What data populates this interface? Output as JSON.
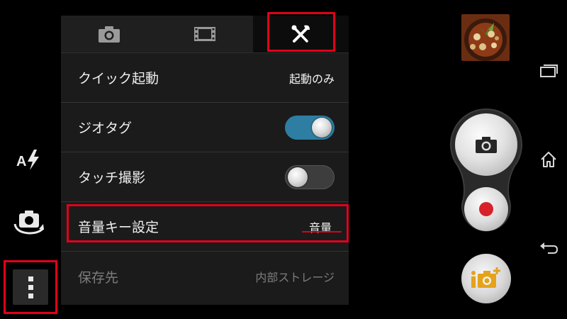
{
  "left_rail": {
    "flash_icon": "auto-flash-icon",
    "switch_camera_icon": "switch-camera-icon",
    "more_icon": "more-vertical-icon"
  },
  "tabs": [
    {
      "icon": "camera-icon",
      "selected": false
    },
    {
      "icon": "film-icon",
      "selected": false
    },
    {
      "icon": "tools-icon",
      "selected": true
    }
  ],
  "settings": {
    "quick_launch": {
      "label": "クイック起動",
      "value": "起動のみ"
    },
    "geotag": {
      "label": "ジオタグ",
      "state": "on"
    },
    "touch_capture": {
      "label": "タッチ撮影",
      "state": "off"
    },
    "volume_key": {
      "label": "音量キー設定",
      "value": "音量"
    },
    "storage": {
      "label": "保存先",
      "value": "内部ストレージ"
    }
  },
  "colors": {
    "highlight": "#e1001b",
    "toggle_on": "#2d7ea2",
    "record": "#d8202a",
    "apps_orange": "#e5a21a"
  },
  "right_controls": {
    "thumbnail": "last-photo-thumbnail",
    "shutter_icon": "camera-icon",
    "record_icon": "record-icon",
    "apps_icon": "camera-apps-icon"
  },
  "nav": [
    "recent-apps-icon",
    "home-icon",
    "back-icon"
  ]
}
